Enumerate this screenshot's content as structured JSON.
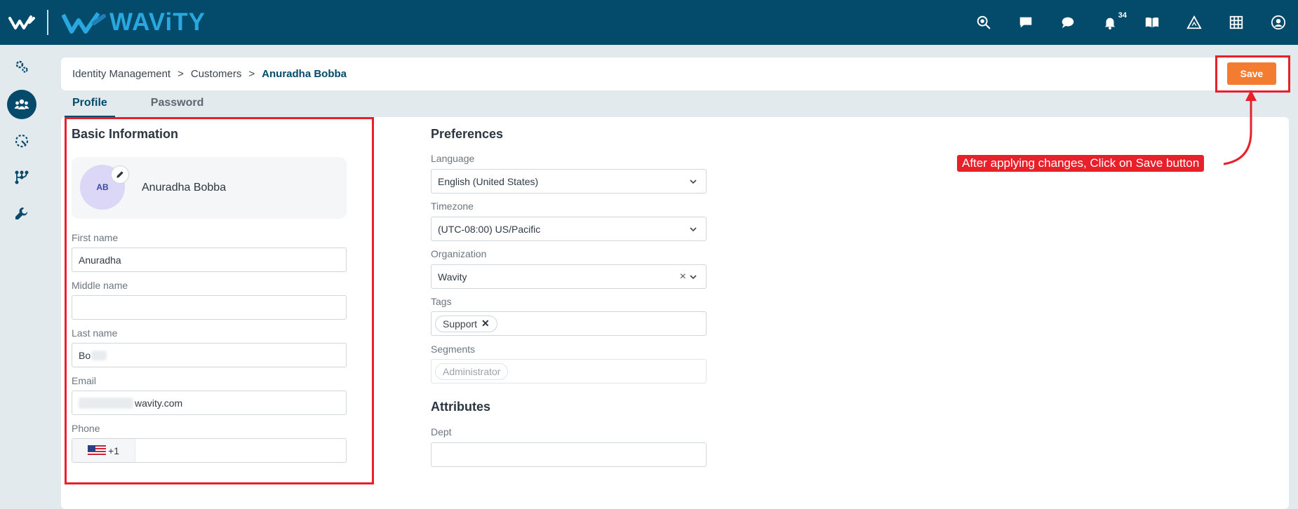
{
  "header": {
    "brand": "WAViTY",
    "notification_count": "34",
    "icons": [
      "support-search-icon",
      "chat-square-icon",
      "chat-bubble-icon",
      "bell-icon",
      "book-icon",
      "triangle-icon",
      "grid-icon",
      "user-icon"
    ]
  },
  "sidebar": {
    "items": [
      {
        "name": "settings-gears-icon",
        "active": false
      },
      {
        "name": "users-icon",
        "active": true
      },
      {
        "name": "dashed-circle-icon",
        "active": false
      },
      {
        "name": "workflow-icon",
        "active": false
      },
      {
        "name": "wrench-icon",
        "active": false
      }
    ]
  },
  "breadcrumb": {
    "items": [
      "Identity Management",
      "Customers"
    ],
    "separator": ">",
    "current": "Anuradha Bobba"
  },
  "toolbar": {
    "save_label": "Save"
  },
  "tabs": [
    {
      "label": "Profile",
      "active": true
    },
    {
      "label": "Password",
      "active": false
    }
  ],
  "basic_info": {
    "title": "Basic Information",
    "avatar_initials": "AB",
    "display_name": "Anuradha Bobba",
    "first_name_label": "First name",
    "first_name_value": "Anuradha",
    "middle_name_label": "Middle name",
    "middle_name_value": "",
    "last_name_label": "Last name",
    "last_name_value": "Bo",
    "email_label": "Email",
    "email_value": "wavity.com",
    "phone_label": "Phone",
    "phone_code": "+1",
    "phone_value": ""
  },
  "preferences": {
    "title": "Preferences",
    "language_label": "Language",
    "language_value": "English (United States)",
    "timezone_label": "Timezone",
    "timezone_value": "(UTC-08:00) US/Pacific",
    "organization_label": "Organization",
    "organization_value": "Wavity",
    "clear_symbol": "×",
    "tags_label": "Tags",
    "tags": [
      "Support"
    ],
    "tag_remove_symbol": "✕",
    "segments_label": "Segments",
    "segments": [
      "Administrator"
    ]
  },
  "attributes": {
    "title": "Attributes",
    "dept_label": "Dept",
    "dept_value": ""
  },
  "annotation": {
    "callout_text": "After applying changes, Click on Save button"
  },
  "colors": {
    "header_bg": "#034a6b",
    "brand_blue": "#29a8e0",
    "save_orange": "#f47c30",
    "annotation_red": "#e8202a"
  }
}
